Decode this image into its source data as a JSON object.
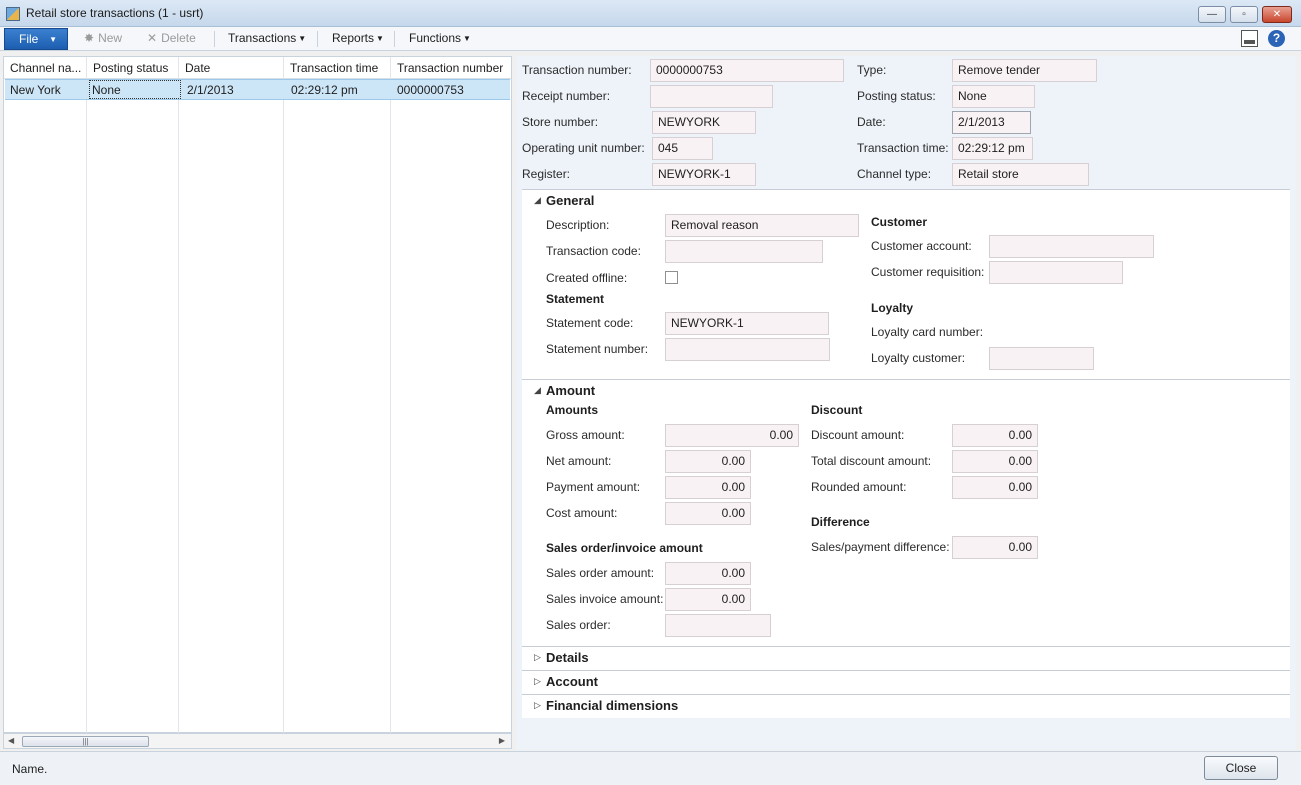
{
  "window": {
    "title": "Retail store transactions (1 - usrt)"
  },
  "menu": {
    "file": "File",
    "new": "New",
    "delete": "Delete",
    "transactions": "Transactions",
    "reports": "Reports",
    "functions": "Functions"
  },
  "grid": {
    "columns": [
      "Channel na...",
      "Posting status",
      "Date",
      "Transaction time",
      "Transaction number"
    ],
    "rows": [
      [
        "New York",
        "None",
        "2/1/2013",
        "02:29:12 pm",
        "0000000753"
      ]
    ]
  },
  "header_fields": {
    "transaction_number": {
      "label": "Transaction number:",
      "value": "0000000753"
    },
    "receipt_number": {
      "label": "Receipt number:",
      "value": ""
    },
    "store_number": {
      "label": "Store number:",
      "value": "NEWYORK"
    },
    "operating_unit_number": {
      "label": "Operating unit number:",
      "value": "045"
    },
    "register": {
      "label": "Register:",
      "value": "NEWYORK-1"
    },
    "type": {
      "label": "Type:",
      "value": "Remove tender"
    },
    "posting_status": {
      "label": "Posting status:",
      "value": "None"
    },
    "date": {
      "label": "Date:",
      "value": "2/1/2013"
    },
    "transaction_time": {
      "label": "Transaction time:",
      "value": "02:29:12 pm"
    },
    "channel_type": {
      "label": "Channel type:",
      "value": "Retail store"
    }
  },
  "general": {
    "title": "General",
    "description": {
      "label": "Description:",
      "value": "Removal reason"
    },
    "transaction_code": {
      "label": "Transaction code:",
      "value": ""
    },
    "created_offline": {
      "label": "Created offline:",
      "checked": false
    },
    "statement_group": "Statement",
    "statement_code": {
      "label": "Statement code:",
      "value": "NEWYORK-1"
    },
    "statement_number": {
      "label": "Statement number:",
      "value": ""
    },
    "customer_group": "Customer",
    "customer_account": {
      "label": "Customer account:",
      "value": ""
    },
    "customer_requisition": {
      "label": "Customer requisition:",
      "value": ""
    },
    "loyalty_group": "Loyalty",
    "loyalty_card_number": {
      "label": "Loyalty card number:",
      "value": ""
    },
    "loyalty_customer": {
      "label": "Loyalty customer:",
      "value": ""
    }
  },
  "amount": {
    "title": "Amount",
    "amounts_group": "Amounts",
    "gross_amount": {
      "label": "Gross amount:",
      "value": "0.00"
    },
    "net_amount": {
      "label": "Net amount:",
      "value": "0.00"
    },
    "payment_amount": {
      "label": "Payment amount:",
      "value": "0.00"
    },
    "cost_amount": {
      "label": "Cost amount:",
      "value": "0.00"
    },
    "sales_group": "Sales order/invoice amount",
    "sales_order_amount": {
      "label": "Sales order amount:",
      "value": "0.00"
    },
    "sales_invoice_amount": {
      "label": "Sales invoice amount:",
      "value": "0.00"
    },
    "sales_order": {
      "label": "Sales order:",
      "value": ""
    },
    "discount_group": "Discount",
    "discount_amount": {
      "label": "Discount amount:",
      "value": "0.00"
    },
    "total_discount_amount": {
      "label": "Total discount amount:",
      "value": "0.00"
    },
    "rounded_amount": {
      "label": "Rounded amount:",
      "value": "0.00"
    },
    "difference_group": "Difference",
    "sales_payment_difference": {
      "label": "Sales/payment difference:",
      "value": "0.00"
    }
  },
  "collapsed_tabs": {
    "details": "Details",
    "account": "Account",
    "financial_dimensions": "Financial dimensions"
  },
  "status": {
    "text": "Name.",
    "close_button": "Close"
  },
  "icons": {
    "new": "sparkle-icon",
    "delete": "x-icon",
    "layout": "layout-icon",
    "help": "help-icon"
  },
  "colors": {
    "accent": "#1d5eb0",
    "selected_row": "#cde6f7",
    "field_bg": "#f9f2f4"
  }
}
